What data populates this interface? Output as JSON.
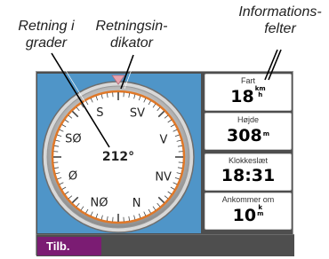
{
  "callouts": {
    "heading": [
      "Retning i",
      "grader"
    ],
    "indicator": [
      "Retningsin-",
      "dikator"
    ],
    "fields": [
      "Informations-",
      "felter"
    ]
  },
  "compass": {
    "heading_value": "212°",
    "cardinals": [
      "S",
      "SV",
      "V",
      "NV",
      "N",
      "NØ",
      "Ø",
      "SØ"
    ]
  },
  "fields": [
    {
      "label": "Fart",
      "value": "18",
      "unit_top": "km",
      "unit_bottom": "h"
    },
    {
      "label": "Højde",
      "value": "308",
      "unit_top": "",
      "unit_bottom": "m"
    },
    {
      "label": "Klokkeslæt",
      "value": "18:31",
      "unit_top": "",
      "unit_bottom": ""
    },
    {
      "label": "Ankommer om",
      "value": "10",
      "unit_top": "k",
      "unit_bottom": "m"
    }
  ],
  "bottom_bar": {
    "back_label": "Tilb."
  },
  "colors": {
    "background": "#4f95c8",
    "bezel_orange": "#e07828",
    "back_button": "#7b1c73",
    "pointer": "#e8a2ad"
  }
}
